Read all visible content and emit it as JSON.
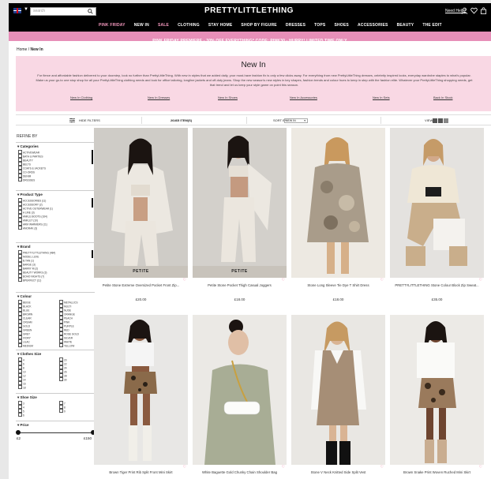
{
  "header": {
    "logo": "PRETTYLITTLETHING",
    "search_placeholder": "search",
    "need_help": "Need Help?",
    "icons": [
      "user-icon",
      "heart-icon",
      "bag-icon"
    ]
  },
  "nav": {
    "items": [
      "PINK FRIDAY",
      "NEW IN",
      "SALE",
      "CLOTHING",
      "STAY HOME",
      "SHOP BY FIGURE",
      "DRESSES",
      "TOPS",
      "SHOES",
      "ACCESSORIES",
      "BEAUTY",
      "THE EDIT"
    ]
  },
  "promo": "PINK FRIDAY PREMIERE - 30% OFF EVERYTHING* CODE: PINK30 - HURRY! LIMITED TIME ONLY",
  "breadcrumb": {
    "home": "Home",
    "sep": "/",
    "current": "New In"
  },
  "hero": {
    "title": "New In",
    "text": "For fierce and affordable fashion delivered to your doorstep, look no further than PrettyLittleThing. With new in styles that we added daily, your must-have fashion fix is only a few clicks away. For everything from new PrettyLittleThing dresses, celebrity inspired looks, everyday wardrobe staples to what's popular. Make us your go-to one stop shop for all your PrettyLittleThing clothing needs and look for office tailoring, longline jackets and off-duty jeans. Shop the new season's new styles in key shapes, fashion trends and colour hues to keep in step with the fashion elite. Whatever your PrettyLittleThing shopping needs, get that trend and let us keep your style game on point this season.",
    "links": [
      "New In Clothing",
      "New In Dresses",
      "New In Shoes",
      "New In Accessories",
      "New In Sets",
      "Back In Stock"
    ]
  },
  "toolbar": {
    "hide_filters": "HIDE FILTERS",
    "count": "26465 ITEM(S)",
    "sort_label": "SORT BY",
    "sort_value": "NEW IN",
    "view_label": "VIEW"
  },
  "sidebar": {
    "refine": "REFINE BY",
    "categories": {
      "title": "Categories",
      "options": [
        "ACTIVEWEAR",
        "BATH & PARTIES",
        "BEAUTY",
        "BELTS",
        "COATS & JACKETS",
        "CO-ORDS",
        "DENIM",
        "DRESSES"
      ]
    },
    "product_type": {
      "title": "Product Type",
      "options": [
        "ACCESSORIES (11)",
        "ACCESSORY (2)",
        "ACTIVE OUTERWEAR (1)",
        "A LINE (3)",
        "ANKLE BOOTS (164)",
        "ANKLET (10)",
        "ARM WARMERS (11)",
        "ANORAK (3)"
      ]
    },
    "brand": {
      "title": "Brand",
      "options": [
        "PRETTYLITTLETHING (484)",
        "MODEL LUXE",
        "B.TAN (1)",
        "BARGE (3)",
        "BARRY M (2)",
        "BEAUTY WORKS (3)",
        "BOHO NIGHTS (7)",
        "BPERFECT (11)"
      ]
    },
    "colour": {
      "title": "Colour",
      "left": [
        "BEIGE",
        "BLACK",
        "BLUE",
        "BROWN",
        "CLEAR",
        "CREAM",
        "GOLD",
        "GREEN",
        "GREY",
        "IVORY",
        "LILAC",
        "MEDIUM"
      ],
      "right": [
        "METALLICS",
        "MULTI",
        "NUDE",
        "ORANGE",
        "PEACH",
        "PINK",
        "PURPLE",
        "RED",
        "ROSE GOLD",
        "SILVER",
        "WHITE",
        "YELLOW"
      ]
    },
    "clothes_size": {
      "title": "Clothes Size",
      "left": [
        "4",
        "6",
        "8",
        "10",
        "12",
        "14",
        "16",
        "18"
      ],
      "right": [
        "20",
        "22",
        "24",
        "26",
        "28",
        "30"
      ]
    },
    "shoe_size": {
      "title": "Shoe Size",
      "left": [
        "3",
        "4",
        "5",
        "6"
      ],
      "right": [
        "7",
        "8",
        "9"
      ]
    },
    "price": {
      "title": "Price",
      "min": "£2",
      "max": "£150"
    }
  },
  "products": [
    {
      "name": "Petite Stone Extreme Oversized Pocket Front Zip...",
      "price": "£20.00",
      "badge": "PETITE"
    },
    {
      "name": "Petite Stone Pocket Thigh Casual Joggers",
      "price": "£18.00",
      "badge": "PETITE"
    },
    {
      "name": "Stone Long Sleeve Tie Dye T Shirt Dress",
      "price": "£18.00",
      "badge": ""
    },
    {
      "name": "PRETTYLITTLETHING Stone Colour Block Zip Sweat...",
      "price": "£35.00",
      "badge": ""
    },
    {
      "name": "Brown Tiger Print Rib Split Front Mini Skirt",
      "price": "",
      "badge": ""
    },
    {
      "name": "White Baguette Gold Chunky Chain Shoulder Bag",
      "price": "",
      "badge": ""
    },
    {
      "name": "Stone V Neck Knitted Side Split Vest",
      "price": "",
      "badge": ""
    },
    {
      "name": "Brown Snake Print Woven Ruched Mini Skirt",
      "price": "",
      "badge": ""
    }
  ],
  "colors": {
    "topbar": "#000000",
    "promo": "#e78fb8",
    "hero": "#f9d8e4",
    "accent_pink": "#f79ac0"
  }
}
